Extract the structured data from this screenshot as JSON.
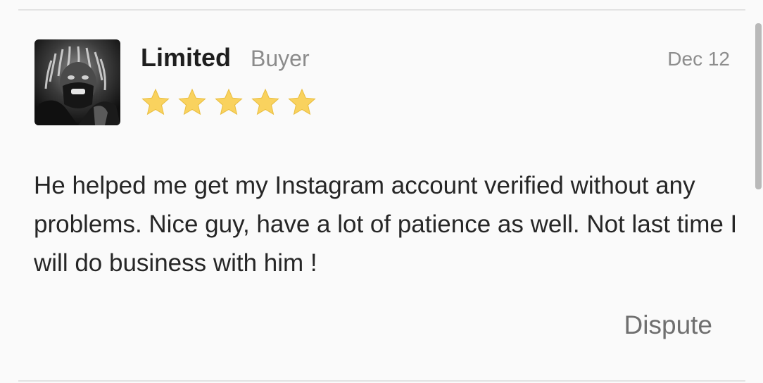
{
  "review": {
    "reviewer_name": "Limited",
    "reviewer_role": "Buyer",
    "date": "Dec 12",
    "rating": 5,
    "rating_max": 5,
    "text": "He helped me get my Instagram account verified without any problems. Nice guy, have a lot of patience as well. Not last time I will do business with him !",
    "dispute_label": "Dispute",
    "avatar_icon": "user-avatar-photo",
    "star_icon": "star-icon",
    "colors": {
      "star_fill": "#f9d25e",
      "name": "#1e1e1e",
      "meta": "#8b8b8b",
      "body": "#262626",
      "dispute": "#6f6f6f"
    }
  }
}
